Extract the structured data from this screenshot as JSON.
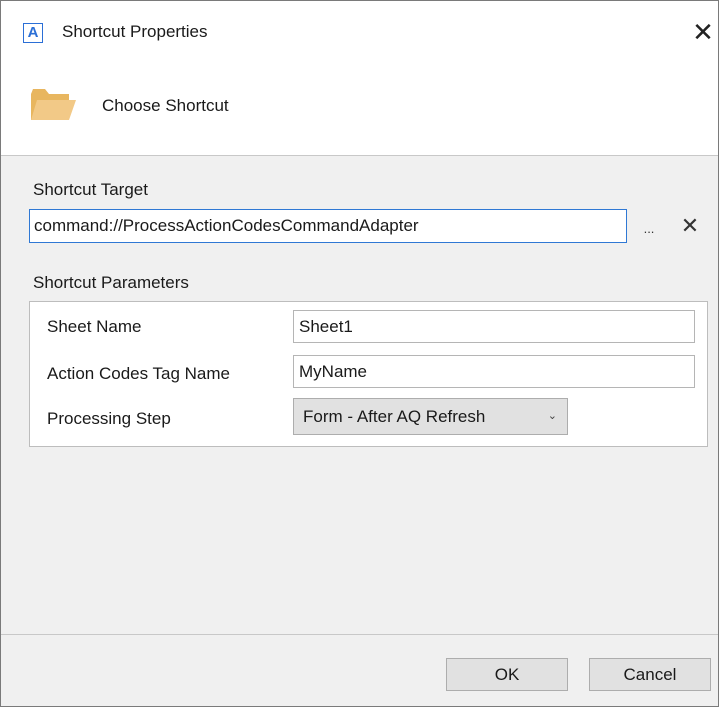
{
  "window": {
    "title": "Shortcut Properties",
    "app_icon_letter": "A",
    "close_glyph": "✕"
  },
  "header": {
    "icon": "folder-icon",
    "choose_label": "Choose Shortcut"
  },
  "target": {
    "label": "Shortcut Target",
    "value": "command://ProcessActionCodesCommandAdapter",
    "browse_label": "...",
    "clear_glyph": "✕"
  },
  "parameters": {
    "label": "Shortcut Parameters",
    "items": [
      {
        "label": "Sheet Name",
        "value": "Sheet1"
      },
      {
        "label": "Action Codes Tag Name",
        "value": "MyName"
      },
      {
        "label": "Processing Step",
        "value": "Form - After AQ Refresh"
      }
    ]
  },
  "footer": {
    "ok_label": "OK",
    "cancel_label": "Cancel"
  },
  "colors": {
    "accent": "#2f78d4",
    "folder": "#f2c987",
    "panel": "#f0f0f0"
  }
}
